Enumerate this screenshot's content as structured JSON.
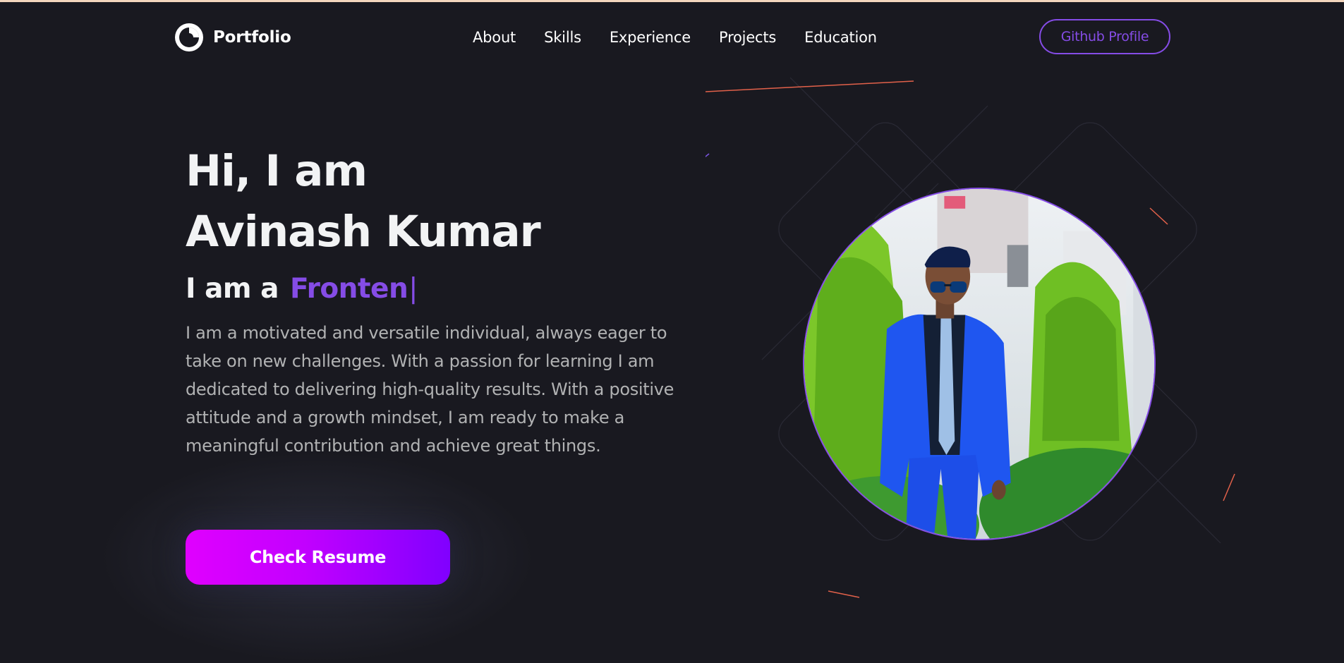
{
  "navbar": {
    "brand": "Portfolio",
    "links": [
      {
        "label": "About"
      },
      {
        "label": "Skills"
      },
      {
        "label": "Experience"
      },
      {
        "label": "Projects"
      },
      {
        "label": "Education"
      }
    ],
    "github_button": "Github Profile"
  },
  "hero": {
    "greeting": "Hi, I am",
    "name": "Avinash Kumar",
    "role_prefix": "I am a",
    "role_typed": "Fronten",
    "description": "I am a motivated and versatile individual, always eager to take on new challenges. With a passion for learning I am dedicated to delivering high-quality results. With a positive attitude and a growth mindset, I am ready to make a meaningful contribution and achieve great things.",
    "resume_button": "Check Resume"
  },
  "colors": {
    "background": "#191920",
    "accent": "#854ce6",
    "text_primary": "#f2f3f4",
    "text_secondary": "#b1b2b3",
    "button_gradient_start": "#e000ff",
    "button_gradient_end": "#8000ff"
  },
  "icons": {
    "brand_logo": "portfolio-logo-icon"
  }
}
